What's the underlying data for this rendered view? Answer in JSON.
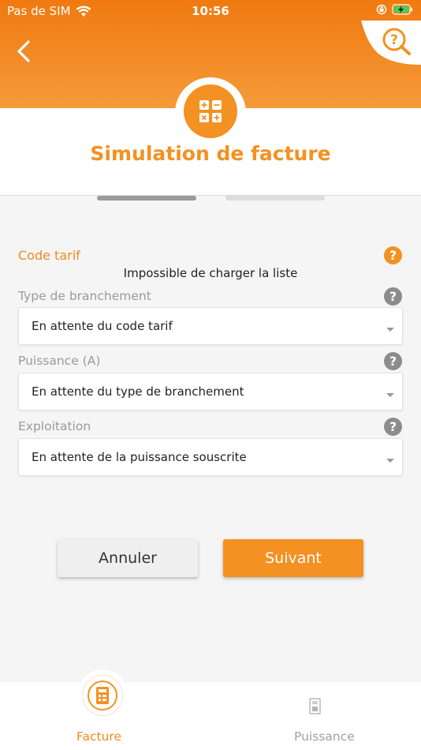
{
  "status_bar": {
    "carrier": "Pas de SIM",
    "time": "10:56"
  },
  "header": {
    "title": "Simulation de facture"
  },
  "form": {
    "code_tarif": {
      "label": "Code tarif",
      "error": "Impossible de charger la liste"
    },
    "type_branchement": {
      "label": "Type de branchement",
      "value": "En attente du code tarif"
    },
    "puissance": {
      "label": "Puissance (A)",
      "value": "En attente du type de branchement"
    },
    "exploitation": {
      "label": "Exploitation",
      "value": "En attente de la puissance souscrite"
    },
    "help_glyph": "?"
  },
  "actions": {
    "cancel_label": "Annuler",
    "next_label": "Suivant"
  },
  "tabs": [
    {
      "label": "Facture"
    },
    {
      "label": "Puissance"
    }
  ],
  "colors": {
    "accent": "#f39122",
    "header_gradient_top": "#f07a10",
    "inactive": "#9a9a9a"
  },
  "icons": [
    "back-arrow",
    "search-help",
    "calculator",
    "question-mark",
    "invoice",
    "meter"
  ]
}
